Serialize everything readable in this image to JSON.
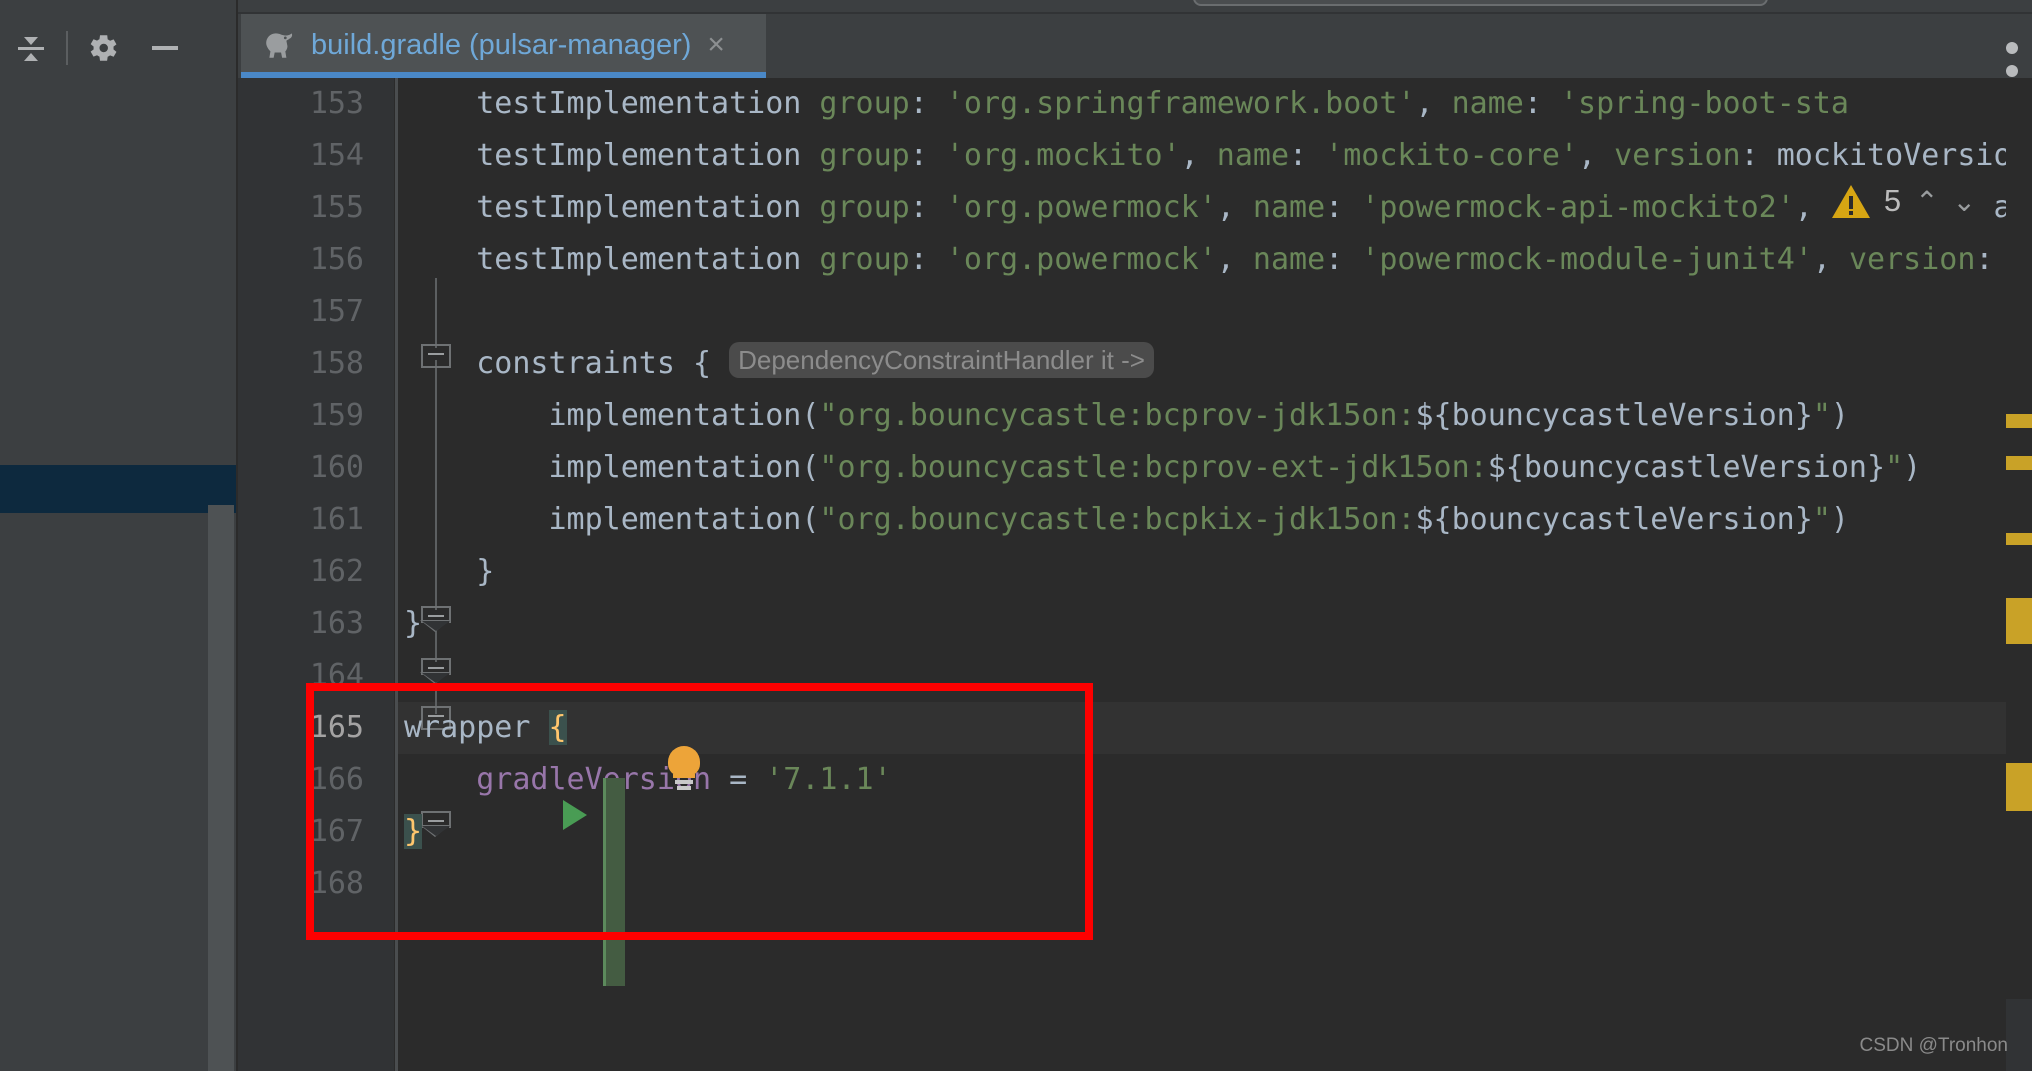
{
  "window": {
    "theme_bg": "#3c3f41",
    "editor_bg": "#2b2b2b",
    "accent": "#4a88c7"
  },
  "toolbar": {
    "collapse_all_label": "collapse-all",
    "settings_label": "settings",
    "minimize_label": "minimize",
    "more_label": "more"
  },
  "tab": {
    "title": "build.gradle (pulsar-manager)",
    "icon": "gradle-elephant-icon",
    "close_label": "×",
    "active": true
  },
  "inspections": {
    "icon": "warning-triangle-icon",
    "count": "5",
    "prev_label": "⌃",
    "next_label": "⌄"
  },
  "editor": {
    "first_line": 153,
    "current_line": 165,
    "lines": [
      {
        "n": "153",
        "segments": [
          {
            "t": "    testImplementation ",
            "c": "plain"
          },
          {
            "t": "group",
            "c": "key"
          },
          {
            "t": ": ",
            "c": "plain"
          },
          {
            "t": "'org.springframework.boot'",
            "c": "str"
          },
          {
            "t": ", ",
            "c": "plain"
          },
          {
            "t": "name",
            "c": "key"
          },
          {
            "t": ": ",
            "c": "plain"
          },
          {
            "t": "'spring-boot-sta",
            "c": "str"
          }
        ]
      },
      {
        "n": "154",
        "segments": [
          {
            "t": "    testImplementation ",
            "c": "plain"
          },
          {
            "t": "group",
            "c": "key"
          },
          {
            "t": ": ",
            "c": "plain"
          },
          {
            "t": "'org.mockito'",
            "c": "str"
          },
          {
            "t": ", ",
            "c": "plain"
          },
          {
            "t": "name",
            "c": "key"
          },
          {
            "t": ": ",
            "c": "plain"
          },
          {
            "t": "'mockito-core'",
            "c": "str"
          },
          {
            "t": ", ",
            "c": "plain"
          },
          {
            "t": "version",
            "c": "key"
          },
          {
            "t": ": mockitoVersion",
            "c": "plain"
          }
        ]
      },
      {
        "n": "155",
        "segments": [
          {
            "t": "    testImplementation ",
            "c": "plain"
          },
          {
            "t": "group",
            "c": "key"
          },
          {
            "t": ": ",
            "c": "plain"
          },
          {
            "t": "'org.powermock'",
            "c": "str"
          },
          {
            "t": ", ",
            "c": "plain"
          },
          {
            "t": "name",
            "c": "key"
          },
          {
            "t": ": ",
            "c": "plain"
          },
          {
            "t": "'powermock-api-mockito2'",
            "c": "str"
          },
          {
            "t": ", ",
            "c": "plain"
          },
          {
            "t": "version",
            "c": "key"
          },
          {
            "t": ": ap",
            "c": "plain"
          }
        ]
      },
      {
        "n": "156",
        "segments": [
          {
            "t": "    testImplementation ",
            "c": "plain"
          },
          {
            "t": "group",
            "c": "key"
          },
          {
            "t": ": ",
            "c": "plain"
          },
          {
            "t": "'org.powermock'",
            "c": "str"
          },
          {
            "t": ", ",
            "c": "plain"
          },
          {
            "t": "name",
            "c": "key"
          },
          {
            "t": ": ",
            "c": "plain"
          },
          {
            "t": "'powermock-module-junit4'",
            "c": "str"
          },
          {
            "t": ", ",
            "c": "plain"
          },
          {
            "t": "version",
            "c": "key"
          },
          {
            "t": ": m",
            "c": "plain"
          }
        ]
      },
      {
        "n": "157",
        "segments": []
      },
      {
        "n": "158",
        "segments": [
          {
            "t": "    constraints { ",
            "c": "plain"
          },
          {
            "t": "DependencyConstraintHandler it ->",
            "c": "inlay"
          }
        ]
      },
      {
        "n": "159",
        "segments": [
          {
            "t": "        implementation(",
            "c": "plain"
          },
          {
            "t": "\"org.bouncycastle:bcprov-jdk15on:",
            "c": "str"
          },
          {
            "t": "${bouncycastleVersion}",
            "c": "plain"
          },
          {
            "t": "\"",
            "c": "str"
          },
          {
            "t": ")",
            "c": "plain"
          }
        ]
      },
      {
        "n": "160",
        "segments": [
          {
            "t": "        implementation(",
            "c": "plain"
          },
          {
            "t": "\"org.bouncycastle:bcprov-ext-jdk15on:",
            "c": "str"
          },
          {
            "t": "${bouncycastleVersion}",
            "c": "plain"
          },
          {
            "t": "\"",
            "c": "str"
          },
          {
            "t": ")",
            "c": "plain"
          }
        ]
      },
      {
        "n": "161",
        "segments": [
          {
            "t": "        implementation(",
            "c": "plain"
          },
          {
            "t": "\"org.bouncycastle:bcpkix-jdk15on:",
            "c": "str"
          },
          {
            "t": "${bouncycastleVersion}",
            "c": "plain"
          },
          {
            "t": "\"",
            "c": "str"
          },
          {
            "t": ")",
            "c": "plain"
          }
        ]
      },
      {
        "n": "162",
        "segments": [
          {
            "t": "    }",
            "c": "plain"
          }
        ]
      },
      {
        "n": "163",
        "segments": [
          {
            "t": "}",
            "c": "plain"
          }
        ]
      },
      {
        "n": "164",
        "segments": []
      },
      {
        "n": "165",
        "segments": [
          {
            "t": "wrapper ",
            "c": "plain"
          },
          {
            "t": "{",
            "c": "brace-hl"
          }
        ]
      },
      {
        "n": "166",
        "segments": [
          {
            "t": "    ",
            "c": "plain"
          },
          {
            "t": "gradleVersion",
            "c": "prop"
          },
          {
            "t": " = ",
            "c": "plain"
          },
          {
            "t": "'7.1.1'",
            "c": "str"
          }
        ]
      },
      {
        "n": "167",
        "segments": [
          {
            "t": "}",
            "c": "brace-hl"
          }
        ]
      },
      {
        "n": "168",
        "segments": []
      }
    ]
  },
  "annotation": {
    "rect_color": "#fe0000",
    "target_lines": "165-168"
  },
  "gutter_icons": {
    "run_arrow": "run-task-arrow-icon",
    "lightbulb": "intention-bulb-icon",
    "change_marker": "vcs-change-stripe"
  },
  "watermark": {
    "text": "CSDN @Tronhon"
  }
}
